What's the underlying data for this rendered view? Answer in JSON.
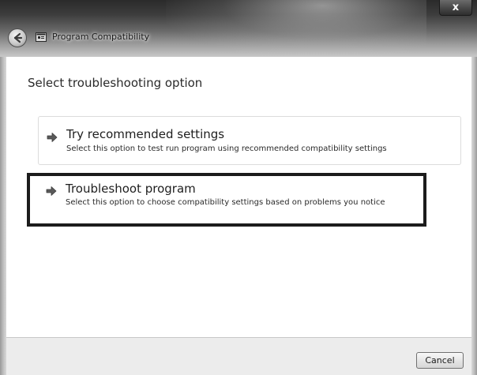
{
  "window": {
    "title": "Program Compatibility",
    "close_label": "x"
  },
  "icons": {
    "back": "back-arrow-icon",
    "title": "program-compatibility-icon",
    "option_arrow": "green-arrow-icon",
    "close": "close-icon"
  },
  "content": {
    "heading": "Select troubleshooting option",
    "options": [
      {
        "title": "Try recommended settings",
        "description": "Select this option to test run program using recommended compatibility settings"
      },
      {
        "title": "Troubleshoot program",
        "description": "Select this option to choose compatibility settings based on problems you notice"
      }
    ]
  },
  "footer": {
    "cancel_label": "Cancel"
  }
}
